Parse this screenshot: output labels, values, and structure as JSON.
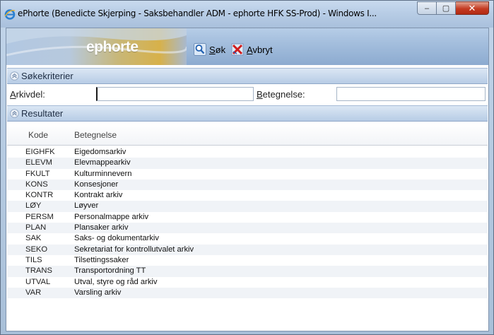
{
  "window": {
    "title": "ePhorte (Benedicte Skjerping - Saksbehandler ADM - ephorte HFK SS-Prod) - Windows I...",
    "buttons": {
      "minimize": "–",
      "maximize": "▢",
      "close": "✕"
    }
  },
  "banner": {
    "logo": "ephorte"
  },
  "toolbar": {
    "search": {
      "mnemonic": "S",
      "rest": "øk",
      "icon": "search-icon"
    },
    "cancel": {
      "mnemonic": "A",
      "rest": "vbryt",
      "icon": "cancel-x-icon"
    }
  },
  "criteria": {
    "section_title": "Søkekriterier",
    "arkivdel": {
      "mnemonic": "A",
      "rest": "rkivdel:",
      "value": ""
    },
    "betegnelse": {
      "mnemonic": "B",
      "rest": "etegnelse:",
      "value": ""
    }
  },
  "results": {
    "section_title": "Resultater",
    "columns": {
      "kode": "Kode",
      "betegnelse": "Betegnelse"
    },
    "rows": [
      {
        "kode": "EIGHFK",
        "betegnelse": "Eigedomsarkiv"
      },
      {
        "kode": "ELEVM",
        "betegnelse": "Elevmappearkiv"
      },
      {
        "kode": "FKULT",
        "betegnelse": "Kulturminnevern"
      },
      {
        "kode": "KONS",
        "betegnelse": "Konsesjoner"
      },
      {
        "kode": "KONTR",
        "betegnelse": "Kontrakt arkiv"
      },
      {
        "kode": "LØY",
        "betegnelse": "Løyver"
      },
      {
        "kode": "PERSM",
        "betegnelse": "Personalmappe arkiv"
      },
      {
        "kode": "PLAN",
        "betegnelse": "Plansaker arkiv"
      },
      {
        "kode": "SAK",
        "betegnelse": "Saks- og dokumentarkiv"
      },
      {
        "kode": "SEKO",
        "betegnelse": "Sekretariat for kontrollutvalet arkiv"
      },
      {
        "kode": "TILS",
        "betegnelse": "Tilsettingssaker"
      },
      {
        "kode": "TRANS",
        "betegnelse": "Transportordning TT"
      },
      {
        "kode": "UTVAL",
        "betegnelse": "Utval, styre og råd arkiv"
      },
      {
        "kode": "VAR",
        "betegnelse": "Varsling arkiv"
      }
    ]
  },
  "colors": {
    "section_text": "#1e2d43",
    "close_button": "#c43b22",
    "logo_gold": "#d7b14a"
  }
}
